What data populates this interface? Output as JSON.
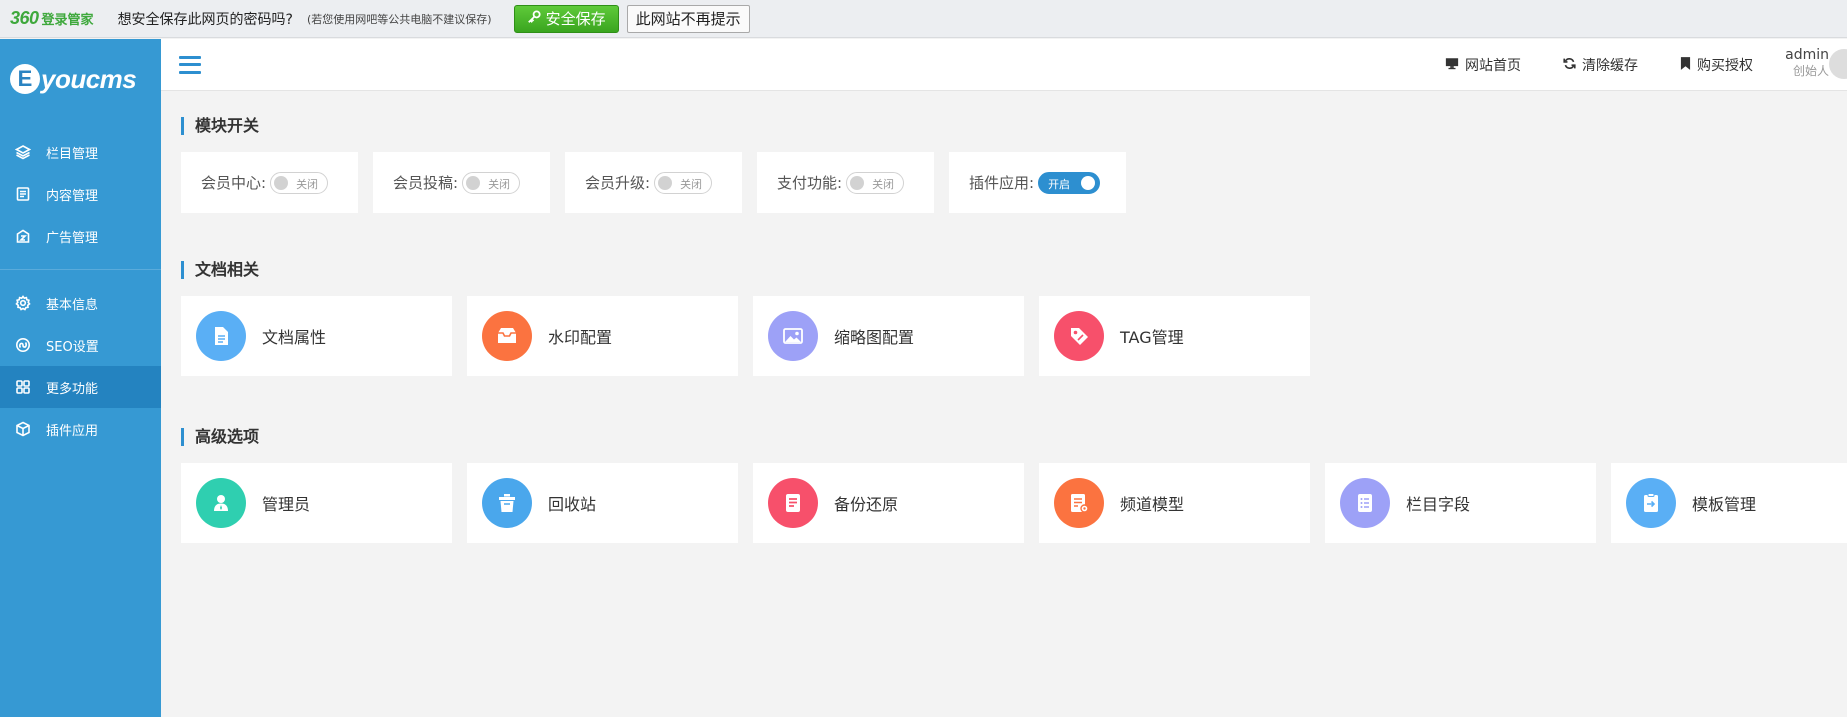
{
  "password_bar": {
    "brand_number": "360",
    "brand_name": "登录管家",
    "question": "想安全保存此网页的密码吗?",
    "note": "(若您使用网吧等公共电脑不建议保存)",
    "save_label": "安全保存",
    "never_label": "此网站不再提示"
  },
  "logo": {
    "badge": "E",
    "text": "youcms"
  },
  "sidebar": {
    "group1": [
      {
        "label": "栏目管理",
        "icon": "layers-icon"
      },
      {
        "label": "内容管理",
        "icon": "document-icon"
      },
      {
        "label": "广告管理",
        "icon": "ad-icon"
      }
    ],
    "group2": [
      {
        "label": "基本信息",
        "icon": "gear-icon"
      },
      {
        "label": "SEO设置",
        "icon": "seo-icon"
      },
      {
        "label": "更多功能",
        "icon": "grid-icon",
        "active": true
      },
      {
        "label": "插件应用",
        "icon": "cube-icon"
      }
    ]
  },
  "header": {
    "actions": [
      {
        "label": "网站首页",
        "icon": "monitor-icon"
      },
      {
        "label": "清除缓存",
        "icon": "refresh-icon"
      },
      {
        "label": "购买授权",
        "icon": "bookmark-icon"
      }
    ],
    "user_name": "admin",
    "user_role": "创始人"
  },
  "sections": {
    "modules": {
      "title": "模块开关",
      "toggles": [
        {
          "label": "会员中心:",
          "state": "关闭",
          "on": false
        },
        {
          "label": "会员投稿:",
          "state": "关闭",
          "on": false
        },
        {
          "label": "会员升级:",
          "state": "关闭",
          "on": false
        },
        {
          "label": "支付功能:",
          "state": "关闭",
          "on": false
        },
        {
          "label": "插件应用:",
          "state": "开启",
          "on": true
        }
      ]
    },
    "docs": {
      "title": "文档相关",
      "items": [
        {
          "label": "文档属性",
          "icon": "doc-attr-icon",
          "color": "#5aaff5"
        },
        {
          "label": "水印配置",
          "icon": "watermark-icon",
          "color": "#fb7340"
        },
        {
          "label": "缩略图配置",
          "icon": "image-icon",
          "color": "#9da1f7"
        },
        {
          "label": "TAG管理",
          "icon": "tag-icon",
          "color": "#f7506b"
        }
      ]
    },
    "advanced": {
      "title": "高级选项",
      "items": [
        {
          "label": "管理员",
          "icon": "admin-icon",
          "color": "#2fcfb0"
        },
        {
          "label": "回收站",
          "icon": "trash-icon",
          "color": "#4aa7ec"
        },
        {
          "label": "备份还原",
          "icon": "backup-icon",
          "color": "#f7506b"
        },
        {
          "label": "频道模型",
          "icon": "channel-icon",
          "color": "#fb7340"
        },
        {
          "label": "栏目字段",
          "icon": "list-icon",
          "color": "#9da1f7"
        },
        {
          "label": "模板管理",
          "icon": "template-icon",
          "color": "#5aaff5"
        }
      ]
    }
  }
}
